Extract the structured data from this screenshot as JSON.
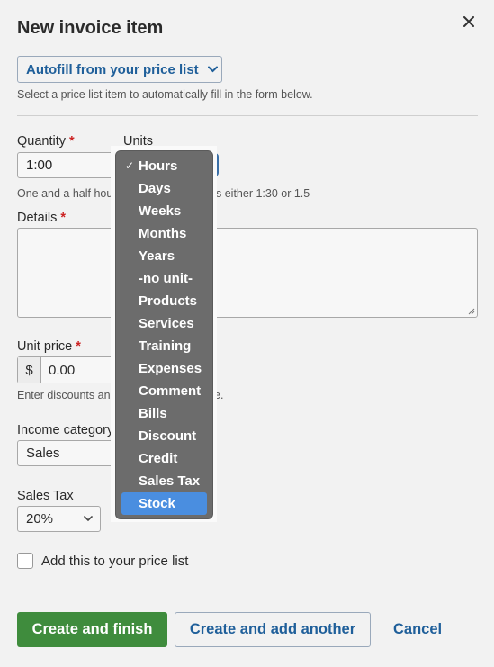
{
  "dialog": {
    "title": "New invoice item",
    "close_icon": "close-icon"
  },
  "autofill": {
    "label": "Autofill from your price list",
    "hint": "Select a price list item to automatically fill in the form below."
  },
  "quantity": {
    "label": "Quantity",
    "required_mark": "*",
    "value": "1:00",
    "hint_visible_start": "One and a half hou",
    "hint_visible_end": "s either 1:30 or 1.5"
  },
  "units": {
    "label": "Units",
    "selected": "Hours",
    "options": [
      "Hours",
      "Days",
      "Weeks",
      "Months",
      "Years",
      "-no unit-",
      "Products",
      "Services",
      "Training",
      "Expenses",
      "Comment",
      "Bills",
      "Discount",
      "Credit",
      "Sales Tax",
      "Stock"
    ],
    "highlighted": "Stock",
    "check_mark": "✓"
  },
  "details": {
    "label": "Details",
    "required_mark": "*",
    "value": ""
  },
  "unit_price": {
    "label": "Unit price",
    "required_mark": "*",
    "currency_symbol": "$",
    "value": "0.00",
    "hint_visible_start": "Enter discounts and",
    "hint_visible_end": "e."
  },
  "income_category": {
    "label": "Income category",
    "value": "Sales"
  },
  "sales_tax": {
    "label": "Sales Tax",
    "value": "20%"
  },
  "price_list_checkbox": {
    "label": "Add this to your price list",
    "checked": false
  },
  "actions": {
    "create_finish": "Create and finish",
    "create_another": "Create and add another",
    "cancel": "Cancel"
  },
  "colors": {
    "primary_green": "#3f8c3d",
    "link_blue": "#1f5f9a",
    "required_red": "#cc2222",
    "dropdown_bg": "#6c6c6c",
    "dropdown_highlight": "#4a8ee0"
  }
}
